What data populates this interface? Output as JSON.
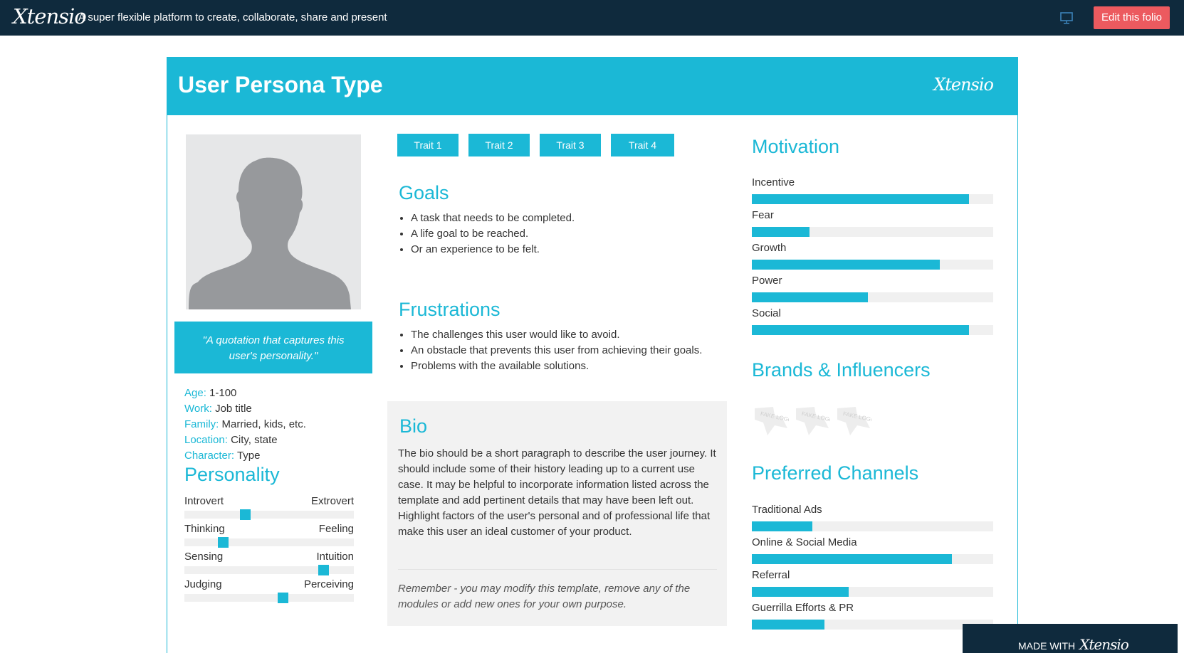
{
  "topbar": {
    "logo": "Xtensio",
    "tagline": "A super flexible platform to create, collaborate, share and present",
    "present_icon": "presentation-screen-icon",
    "edit_button": "Edit this folio"
  },
  "persona": {
    "title": "User Persona Type",
    "brand_logo": "Xtensio",
    "avatar_icon": "person-silhouette-icon",
    "quote": "\"A quotation that captures this user's personality.\"",
    "info": [
      {
        "key": "Age:",
        "value": "1-100"
      },
      {
        "key": "Work:",
        "value": "Job title"
      },
      {
        "key": "Family:",
        "value": "Married, kids, etc."
      },
      {
        "key": "Location:",
        "value": "City, state"
      },
      {
        "key": "Character:",
        "value": "Type"
      }
    ]
  },
  "personality": {
    "title": "Personality",
    "scales": [
      {
        "left": "Introvert",
        "right": "Extrovert",
        "value": 0.36
      },
      {
        "left": "Thinking",
        "right": "Feeling",
        "value": 0.23
      },
      {
        "left": "Sensing",
        "right": "Intuition",
        "value": 0.82
      },
      {
        "left": "Judging",
        "right": "Perceiving",
        "value": 0.58
      }
    ]
  },
  "traits": [
    "Trait 1",
    "Trait 2",
    "Trait 3",
    "Trait 4"
  ],
  "goals": {
    "title": "Goals",
    "items": [
      "A task that needs to be completed.",
      "A life goal to be reached.",
      "Or an experience to be felt."
    ]
  },
  "frustrations": {
    "title": "Frustrations",
    "items": [
      "The challenges this user would like to avoid.",
      "An obstacle that prevents this user from achieving their goals.",
      "Problems with the available solutions."
    ]
  },
  "bio": {
    "title": "Bio",
    "text": "The bio should be a short paragraph to describe the user journey. It should include some of their history leading up to a current use case. It may be helpful to incorporate information listed across the template and add pertinent details that may have been left out. Highlight factors of the user's personal and of professional life that make this user an ideal customer of your product.",
    "remember": "Remember - you may modify this template, remove any of the modules or add new ones for your own purpose."
  },
  "motivation": {
    "title": "Motivation",
    "items": [
      {
        "label": "Incentive",
        "value": 0.9
      },
      {
        "label": "Fear",
        "value": 0.24
      },
      {
        "label": "Growth",
        "value": 0.78
      },
      {
        "label": "Power",
        "value": 0.48
      },
      {
        "label": "Social",
        "value": 0.9
      }
    ]
  },
  "brands": {
    "title": "Brands & Influencers",
    "logos": [
      "fake-logo-1",
      "fake-logo-2",
      "fake-logo-3"
    ],
    "logo_text": "FAKE LOGO"
  },
  "channels": {
    "title": "Preferred Channels",
    "items": [
      {
        "label": "Traditional Ads",
        "value": 0.25
      },
      {
        "label": "Online & Social Media",
        "value": 0.83
      },
      {
        "label": "Referral",
        "value": 0.4
      },
      {
        "label": "Guerrilla Efforts & PR",
        "value": 0.3
      }
    ]
  },
  "footer": {
    "made_with": "MADE WITH",
    "logo": "Xtensio"
  },
  "colors": {
    "accent": "#1bb8d6",
    "topbar": "#0f2a3d",
    "edit_button": "#ec5a5f"
  }
}
